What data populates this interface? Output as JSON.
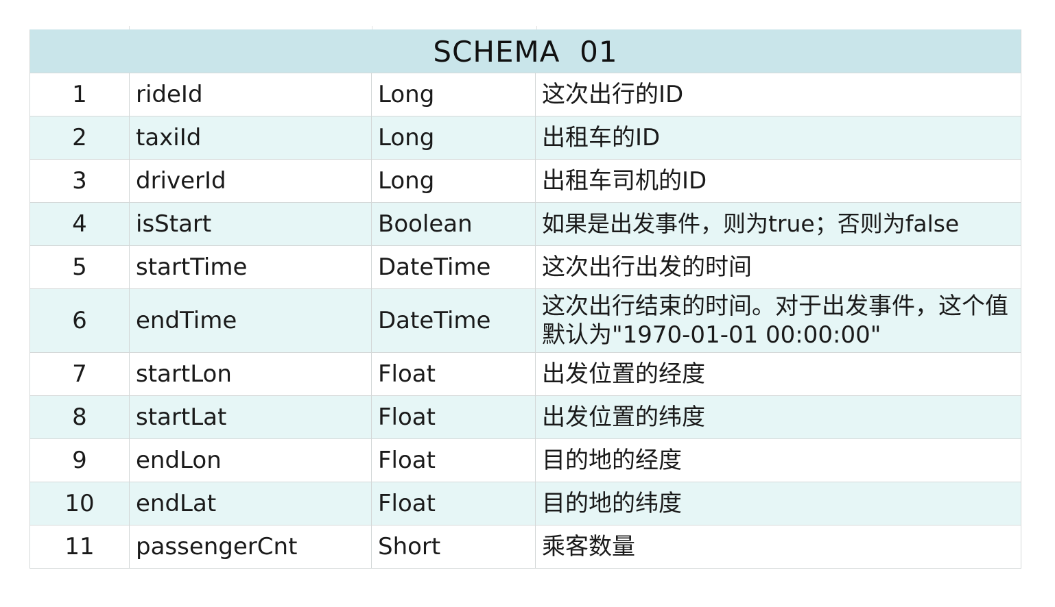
{
  "table": {
    "title": "SCHEMA  01",
    "rows": [
      {
        "index": "1",
        "name": "rideId",
        "type": "Long",
        "description": "这次出行的ID"
      },
      {
        "index": "2",
        "name": "taxiId",
        "type": "Long",
        "description": "出租车的ID"
      },
      {
        "index": "3",
        "name": "driverId",
        "type": "Long",
        "description": "出租车司机的ID"
      },
      {
        "index": "4",
        "name": "isStart",
        "type": "Boolean",
        "description": "如果是出发事件，则为true；否则为false"
      },
      {
        "index": "5",
        "name": "startTime",
        "type": "DateTime",
        "description": "这次出行出发的时间"
      },
      {
        "index": "6",
        "name": "endTime",
        "type": "DateTime",
        "description": "这次出行结束的时间。对于出发事件，这个值默认为\"1970-01-01 00:00:00\""
      },
      {
        "index": "7",
        "name": "startLon",
        "type": "Float",
        "description": "出发位置的经度"
      },
      {
        "index": "8",
        "name": "startLat",
        "type": "Float",
        "description": "出发位置的纬度"
      },
      {
        "index": "9",
        "name": "endLon",
        "type": "Float",
        "description": "目的地的经度"
      },
      {
        "index": "10",
        "name": "endLat",
        "type": "Float",
        "description": "目的地的纬度"
      },
      {
        "index": "11",
        "name": "passengerCnt",
        "type": "Short",
        "description": "乘客数量"
      }
    ]
  },
  "colors": {
    "header_background": "#c9e5ea",
    "alternate_row_background": "#e6f6f6",
    "grid_line": "#d4d8d8"
  }
}
